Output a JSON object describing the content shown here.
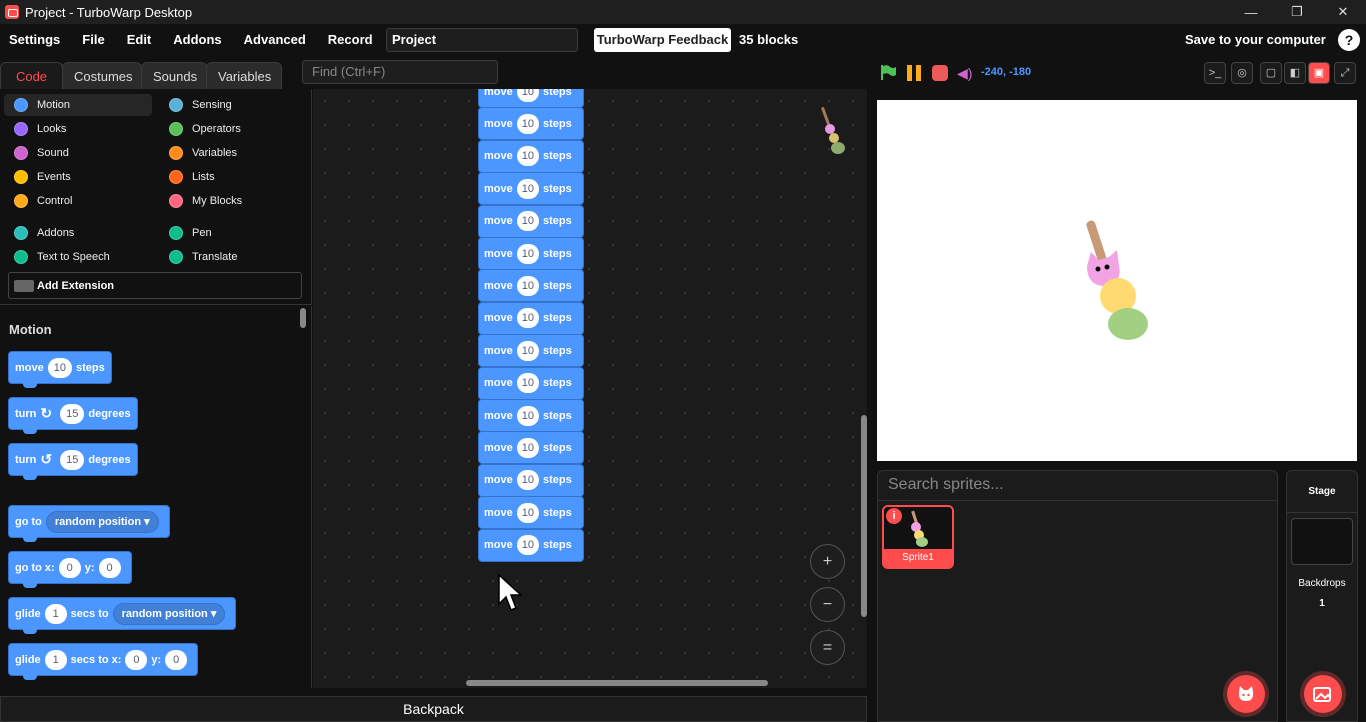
{
  "window": {
    "title": "Project - TurboWarp Desktop",
    "controls": [
      "—",
      "❐",
      "✕"
    ]
  },
  "menubar": {
    "items": [
      "Settings",
      "File",
      "Edit",
      "Addons",
      "Advanced",
      "Record"
    ],
    "project_title": "Project",
    "feedback_label": "TurboWarp Feedback",
    "blocks_count": "35 blocks",
    "save_label": "Save to your computer",
    "help_label": "?"
  },
  "tabs": [
    "Code",
    "Costumes",
    "Sounds",
    "Variables"
  ],
  "find": {
    "placeholder": "Find (Ctrl+F)"
  },
  "categories": [
    {
      "label": "Motion",
      "color": "#4c97ff"
    },
    {
      "label": "Looks",
      "color": "#9966ff"
    },
    {
      "label": "Sound",
      "color": "#cf63cf"
    },
    {
      "label": "Events",
      "color": "#ffbf00"
    },
    {
      "label": "Control",
      "color": "#ffab19"
    },
    {
      "label": "Sensing",
      "color": "#5cb1d6"
    },
    {
      "label": "Operators",
      "color": "#59c059"
    },
    {
      "label": "Variables",
      "color": "#ff8c1a"
    },
    {
      "label": "Lists",
      "color": "#ff661a"
    },
    {
      "label": "My Blocks",
      "color": "#ff6680"
    },
    {
      "label": "Addons",
      "color": "#29beb8"
    },
    {
      "label": "Text to Speech",
      "color": "#0fbd8c"
    },
    {
      "label": "Pen",
      "color": "#0fbd8c"
    },
    {
      "label": "Translate",
      "color": "#0fbd8c"
    }
  ],
  "add_extension_label": "Add Extension",
  "palette": {
    "heading": "Motion",
    "move": {
      "pre": "move",
      "value": "10",
      "post": "steps"
    },
    "turn_right": {
      "pre": "turn",
      "icon": "↻",
      "value": "15",
      "post": "degrees"
    },
    "turn_left": {
      "pre": "turn",
      "icon": "↺",
      "value": "15",
      "post": "degrees"
    },
    "goto": {
      "pre": "go to",
      "menu": "random position ▾"
    },
    "goto_xy": {
      "pre": "go to x:",
      "x": "0",
      "ylabel": "y:",
      "y": "0"
    },
    "glide_to": {
      "pre": "glide",
      "value": "1",
      "mid": "secs to",
      "menu": "random position ▾"
    },
    "glide_xy": {
      "pre": "glide",
      "value": "1",
      "mid": "secs to x:",
      "x": "0",
      "ylabel": "y:",
      "y": "0"
    }
  },
  "script": {
    "block": {
      "pre": "move",
      "value": "10",
      "post": "steps"
    },
    "count_visible": 15
  },
  "zoom": {
    "in": "+",
    "out": "−",
    "reset": "="
  },
  "backpack_label": "Backpack",
  "stage_header": {
    "coords": "-240, -180"
  },
  "sprites": {
    "search_placeholder": "Search sprites...",
    "items": [
      {
        "name": "Sprite1",
        "badge": "i"
      }
    ]
  },
  "stage_pane": {
    "label": "Stage",
    "backdrops_label": "Backdrops",
    "backdrops_count": "1"
  },
  "colors": {
    "accent": "#ff4c4c",
    "motion": "#4c97ff"
  }
}
